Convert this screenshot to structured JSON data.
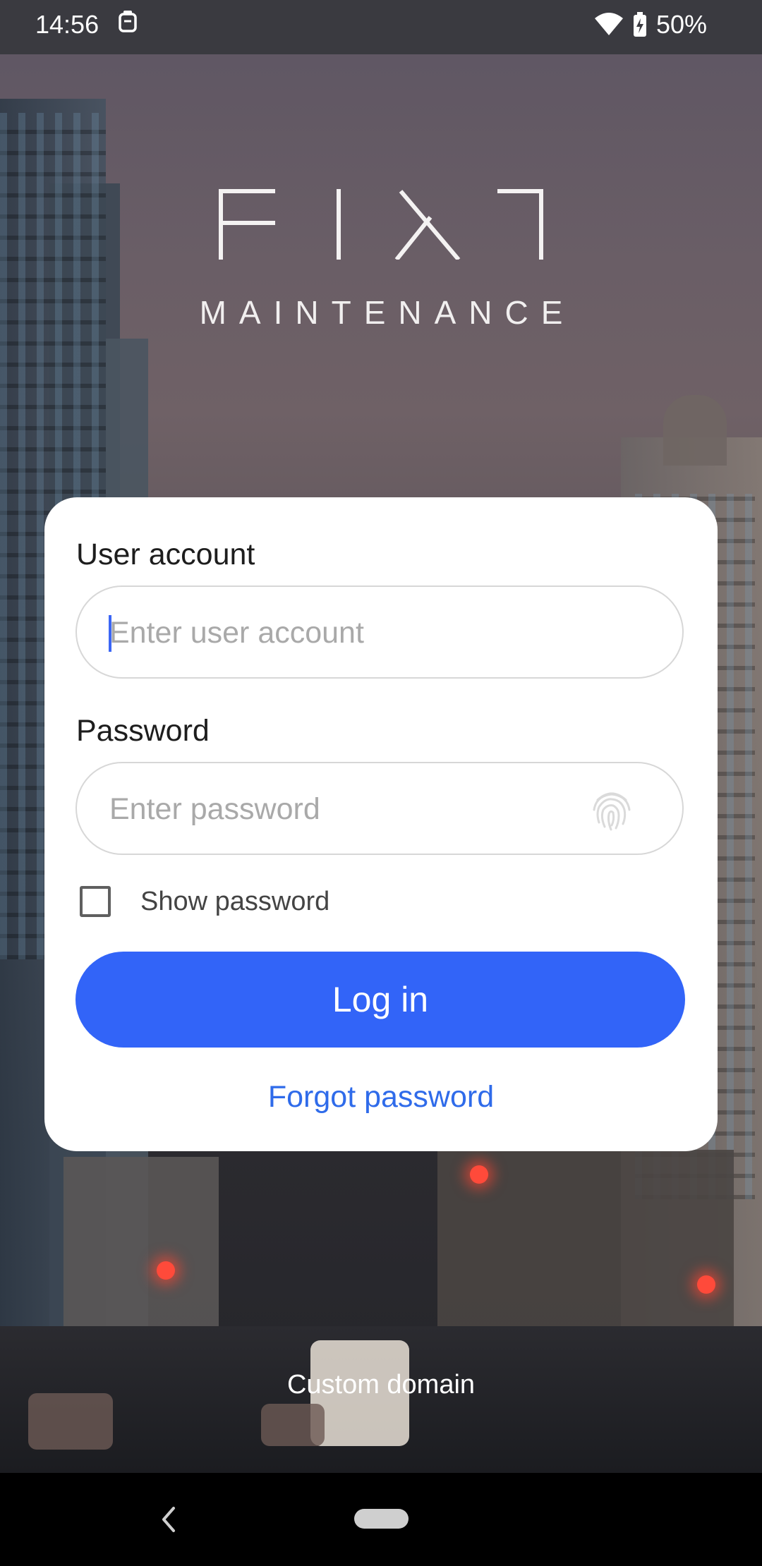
{
  "status_bar": {
    "time": "14:56",
    "battery": "50%"
  },
  "logo": {
    "subtitle": "MAINTENANCE"
  },
  "login": {
    "account_label": "User account",
    "account_placeholder": "Enter user account",
    "password_label": "Password",
    "password_placeholder": "Enter password",
    "show_password_label": "Show password",
    "show_password_checked": false,
    "login_button": "Log in",
    "forgot_password": "Forgot password"
  },
  "footer": {
    "custom_domain": "Custom domain"
  },
  "colors": {
    "accent": "#3264f8",
    "link": "#2f6bea"
  }
}
